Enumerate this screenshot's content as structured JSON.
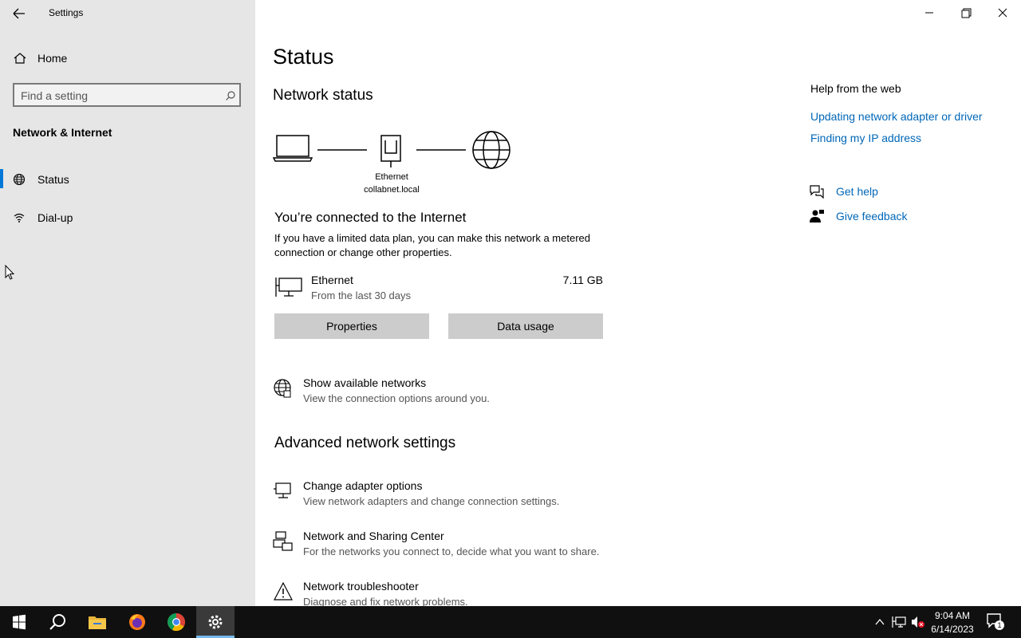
{
  "window": {
    "title": "Settings"
  },
  "sidebar": {
    "home_label": "Home",
    "search_placeholder": "Find a setting",
    "section_title": "Network & Internet",
    "items": [
      {
        "label": "Status",
        "icon": "globe-icon",
        "active": true
      },
      {
        "label": "Dial-up",
        "icon": "dialup-icon",
        "active": false
      }
    ]
  },
  "main": {
    "page_title": "Status",
    "network_status_heading": "Network status",
    "diagram": {
      "adapter_name": "Ethernet",
      "domain": "collabnet.local"
    },
    "connected_heading": "You’re connected to the Internet",
    "connected_desc": "If you have a limited data plan, you can make this network a metered connection or change other properties.",
    "connection": {
      "name": "Ethernet",
      "period": "From the last 30 days",
      "usage": "7.11 GB"
    },
    "buttons": {
      "properties": "Properties",
      "data_usage": "Data usage"
    },
    "show_networks": {
      "title": "Show available networks",
      "desc": "View the connection options around you."
    },
    "advanced_heading": "Advanced network settings",
    "advanced_items": [
      {
        "title": "Change adapter options",
        "desc": "View network adapters and change connection settings.",
        "icon": "adapter-icon"
      },
      {
        "title": "Network and Sharing Center",
        "desc": "For the networks you connect to, decide what you want to share.",
        "icon": "sharing-icon"
      },
      {
        "title": "Network troubleshooter",
        "desc": "Diagnose and fix network problems.",
        "icon": "warning-icon"
      }
    ]
  },
  "help": {
    "heading": "Help from the web",
    "links": [
      "Updating network adapter or driver",
      "Finding my IP address"
    ],
    "get_help": "Get help",
    "give_feedback": "Give feedback"
  },
  "taskbar": {
    "time": "9:04 AM",
    "date": "6/14/2023",
    "notification_count": "1",
    "apps": [
      "start-icon",
      "search-icon",
      "file-explorer-icon",
      "firefox-icon",
      "chrome-icon",
      "settings-icon"
    ]
  },
  "colors": {
    "accent": "#0078d7",
    "link": "#0067b8",
    "sidebar_bg": "#e6e6e6",
    "taskbar_bg": "#101010"
  }
}
